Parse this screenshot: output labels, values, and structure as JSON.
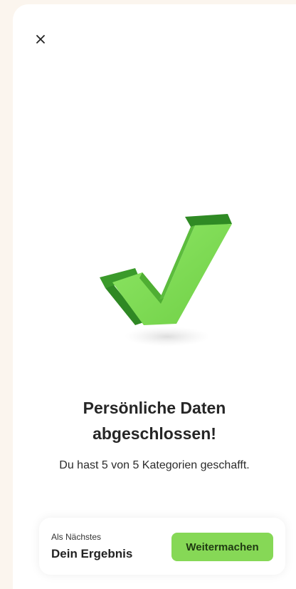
{
  "header": {
    "close_icon": "close-icon"
  },
  "hero": {
    "icon": "checkmark-icon",
    "colors": {
      "front": "#7ddc55",
      "side": "#3d9a2a",
      "top": "#2f8a24"
    }
  },
  "content": {
    "title_line1": "Persönliche Daten",
    "title_line2": "abgeschlossen!",
    "subtitle": "Du hast 5 von 5 Kategorien geschafft."
  },
  "next": {
    "caption": "Als Nächstes",
    "title": "Dein Ergebnis",
    "button_label": "Weitermachen",
    "button_color": "#86d856"
  }
}
